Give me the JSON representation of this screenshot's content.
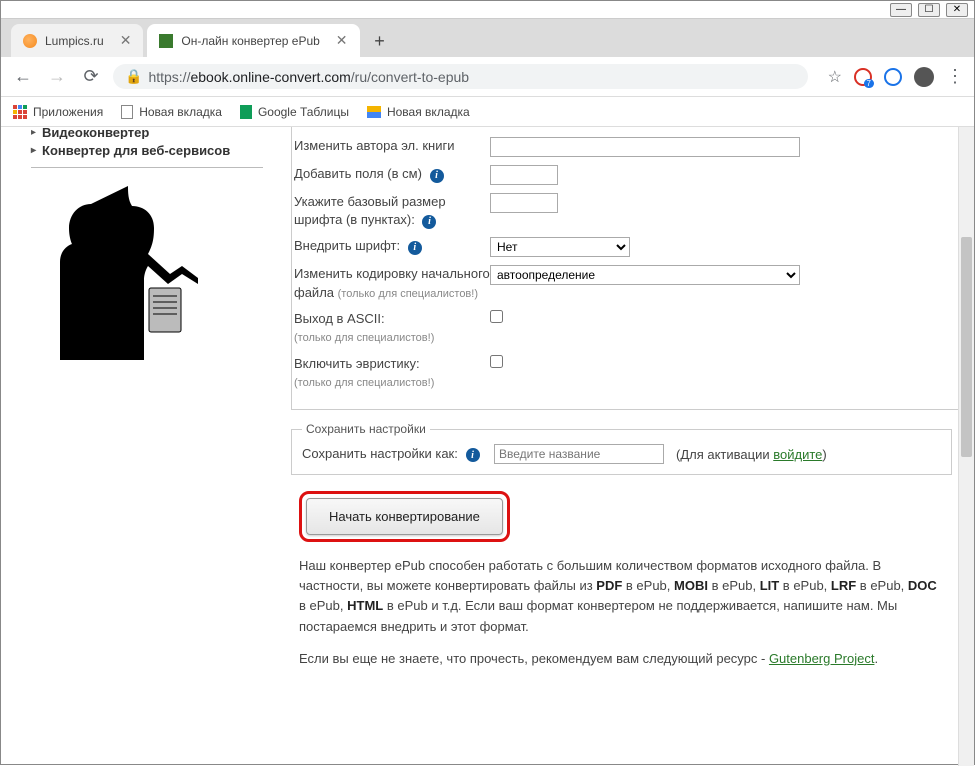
{
  "window": {
    "min": "—",
    "max": "☐",
    "close": "✕"
  },
  "tabs": {
    "t1": "Lumpics.ru",
    "t2": "Он-лайн конвертер ePub",
    "close": "✕",
    "add": "+"
  },
  "nav": {
    "back": "←",
    "fwd": "→",
    "reload": "⟳",
    "lock": "🔒",
    "star": "☆",
    "menu": "⋮"
  },
  "url": {
    "proto": "https://",
    "host": "ebook.online-convert.com",
    "path": "/ru/convert-to-epub"
  },
  "bookmarks": {
    "apps": "Приложения",
    "b1": "Новая вкладка",
    "b2": "Google Таблицы",
    "b3": "Новая вкладка"
  },
  "sidebar": {
    "item_top": "Видеоконвертер",
    "item_bold": "Конвертер для веб-сервисов"
  },
  "form": {
    "author_label": "Изменить автора эл. книги",
    "margins_label": "Добавить поля (в см)",
    "basefont_label": "Укажите базовый размер шрифта (в пунктах):",
    "embed_label": "Внедрить шрифт:",
    "embed_value": "Нет",
    "encoding_label_1": "Изменить кодировку начального файла",
    "specialists_note": "(только для специалистов!)",
    "encoding_value": "автоопределение",
    "ascii_label": "Выход в ASCII:",
    "heur_label": "Включить эвристику:"
  },
  "save": {
    "legend": "Сохранить настройки",
    "label": "Сохранить настройки как:",
    "placeholder": "Введите название",
    "hint_pre": "(Для активации ",
    "hint_link": "войдите",
    "hint_post": ")"
  },
  "convert_btn": "Начать конвертирование",
  "desc": {
    "p1a": "Наш конвертер ePub способен работать с большим количеством форматов исходного файла. В частности, вы можете конвертировать файлы из ",
    "pdf": "PDF",
    "mid1": " в ePub, ",
    "mobi": "MOBI",
    "mid2": " в ePub, ",
    "lit": "LIT",
    "mid3": " в ePub, ",
    "lrf": "LRF",
    "mid4": " в ePub, ",
    "doc": "DOC",
    "mid5": " в ePub, ",
    "html": "HTML",
    "p1b": " в ePub и т.д. Если ваш формат конвертером не поддерживается, напишите нам. Мы постараемся внедрить и этот формат.",
    "p2a": "Если вы еще не знаете, что прочесть, рекомендуем вам следующий ресурс - ",
    "gut": "Gutenberg Project",
    "p2b": "."
  }
}
